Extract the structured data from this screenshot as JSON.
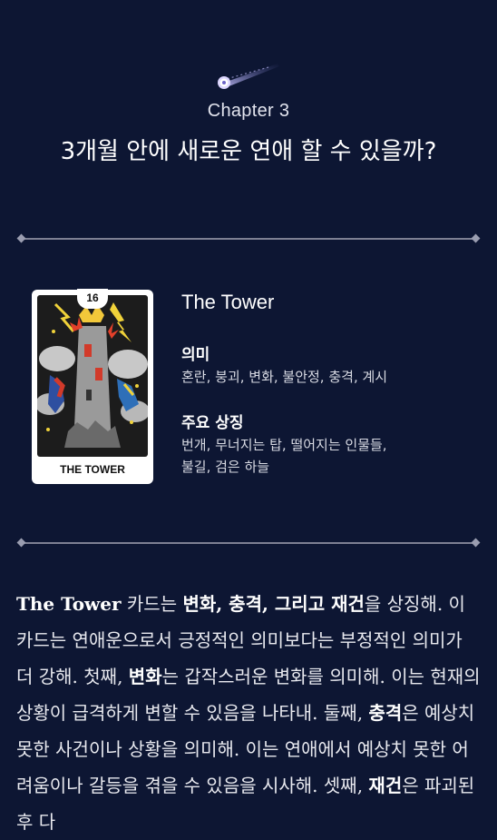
{
  "header": {
    "chapter": "Chapter 3",
    "title": "3개월 안에 새로운 연애 할 수 있을까?"
  },
  "card": {
    "number": "16",
    "caption": "THE TOWER",
    "name": "The Tower",
    "meaning_label": "의미",
    "meaning": "혼란, 붕괴, 변화, 불안정, 충격, 계시",
    "symbols_label": "주요 상징",
    "symbols_line1": "번개, 무너지는 탑, 떨어지는 인물들,",
    "symbols_line2": "불길, 검은 하늘"
  },
  "body": {
    "p1": "The Tower",
    "p2": " 카드는 ",
    "p3": "변화, 충격, 그리고 재건",
    "p4": "을 상징해. 이 카드는 연애운으로서 긍정적인 의미보다는 부정적인 의미가 더 강해. 첫째, ",
    "p5": "변화",
    "p6": "는 갑작스러운 변화를 의미해. 이는 현재의 상황이 급격하게 변할 수 있음을 나타내. 둘째, ",
    "p7": "충격",
    "p8": "은 예상치 못한 사건이나 상황을 의미해. 이는 연애에서 예상치 못한 어려움이나 갈등을 겪을 수 있음을 시사해. 셋째, ",
    "p9": "재건",
    "p10": "은 파괴된 후 다"
  },
  "colors": {
    "background": "#0d1633",
    "divider": "#7d8093",
    "text": "#ffffff"
  },
  "icons": [
    "comet-icon",
    "tower-card-image"
  ]
}
